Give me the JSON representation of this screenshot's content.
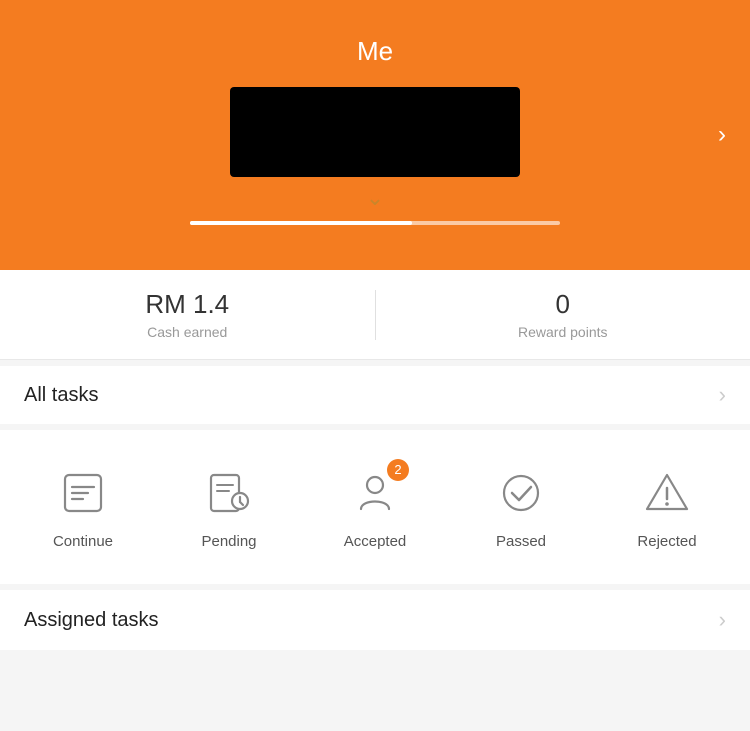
{
  "header": {
    "title": "Me",
    "chevron": "›"
  },
  "stats": {
    "cash_value": "RM 1.4",
    "cash_label": "Cash earned",
    "reward_value": "0",
    "reward_label": "Reward points"
  },
  "all_tasks": {
    "label": "All tasks",
    "chevron": "›"
  },
  "task_icons": [
    {
      "id": "continue",
      "label": "Continue",
      "badge": null
    },
    {
      "id": "pending",
      "label": "Pending",
      "badge": null
    },
    {
      "id": "accepted",
      "label": "Accepted",
      "badge": "2"
    },
    {
      "id": "passed",
      "label": "Passed",
      "badge": null
    },
    {
      "id": "rejected",
      "label": "Rejected",
      "badge": null
    }
  ],
  "assigned_tasks": {
    "label": "Assigned tasks",
    "chevron": "›"
  }
}
